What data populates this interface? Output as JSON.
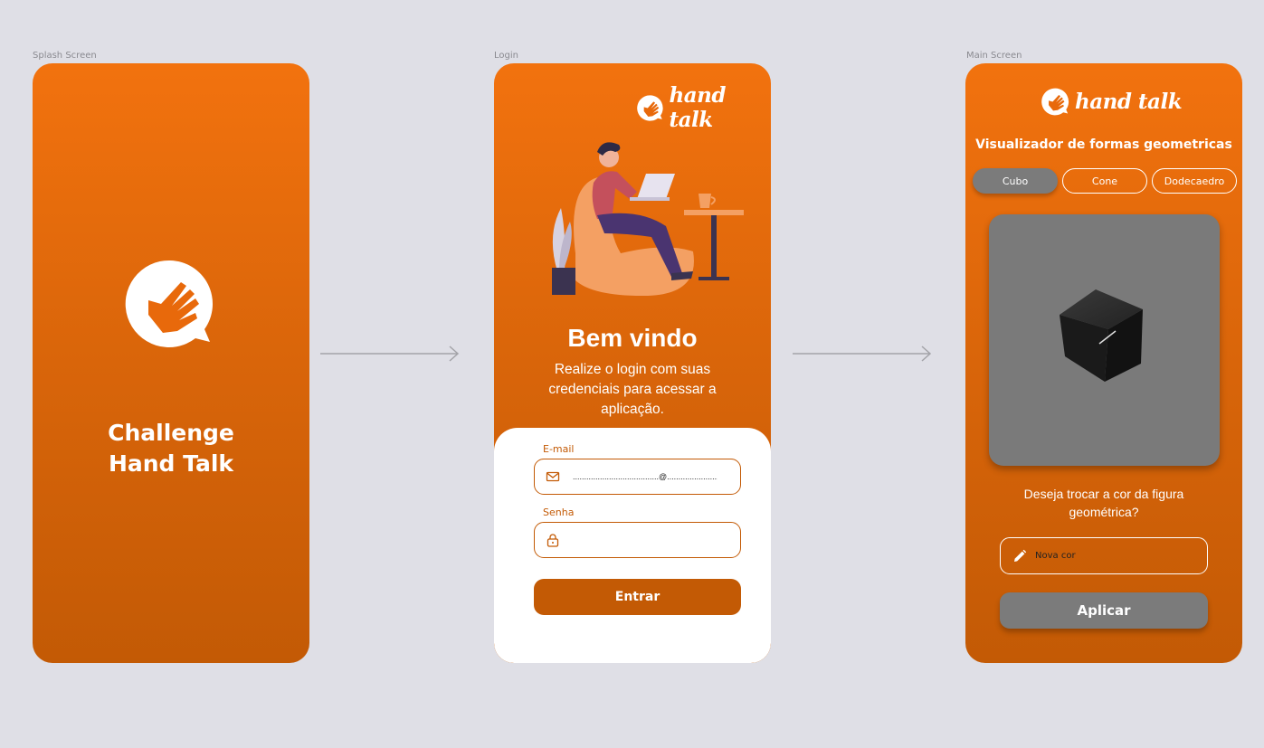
{
  "frames": {
    "splash_label": "Splash Screen",
    "login_label": "Login",
    "main_label": "Main Screen"
  },
  "brand": {
    "name": "hand talk",
    "primary_color": "#f2720e",
    "dark_color": "#c35a05",
    "gray": "#7b7b7b"
  },
  "splash": {
    "title_line1": "Challenge",
    "title_line2": "Hand Talk",
    "icon": "hand-talk-logo-icon"
  },
  "login": {
    "welcome": "Bem vindo",
    "subtitle": "Realize o login com suas credenciais para acessar a aplicação.",
    "email_label": "E-mail",
    "email_value": "......................................@..........................",
    "email_icon": "mail-icon",
    "password_label": "Senha",
    "password_value": "",
    "password_icon": "lock-icon",
    "submit_label": "Entrar"
  },
  "main": {
    "title": "Visualizador de formas geometricas",
    "tabs": [
      {
        "label": "Cubo",
        "active": true
      },
      {
        "label": "Cone",
        "active": false
      },
      {
        "label": "Dodecaedro",
        "active": false
      }
    ],
    "question": "Deseja trocar a cor da figura geométrica?",
    "color_placeholder": "Nova cor",
    "color_icon": "pencil-icon",
    "apply_label": "Aplicar"
  }
}
